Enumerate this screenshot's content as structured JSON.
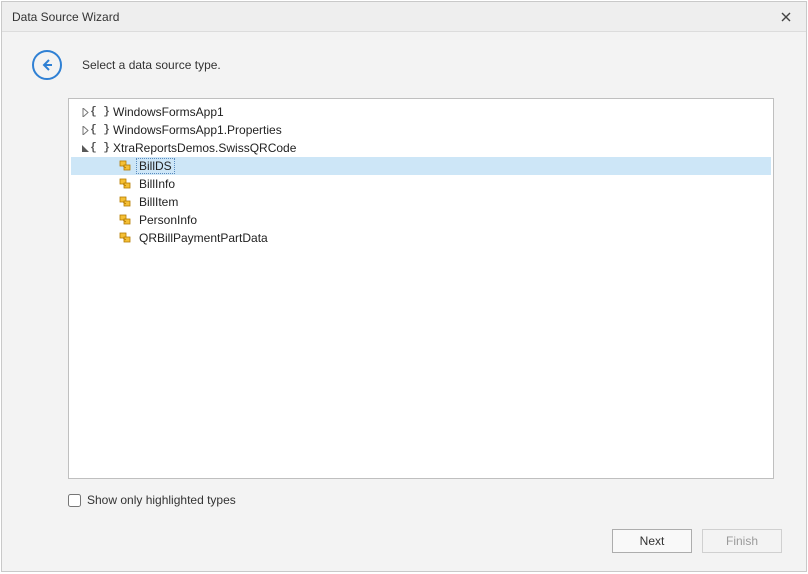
{
  "window": {
    "title": "Data Source Wizard"
  },
  "header": {
    "instruction": "Select a data source type."
  },
  "tree": {
    "nodes": [
      {
        "label": "WindowsFormsApp1",
        "expanded": false,
        "level": 1,
        "kind": "ns"
      },
      {
        "label": "WindowsFormsApp1.Properties",
        "expanded": false,
        "level": 1,
        "kind": "ns"
      },
      {
        "label": "XtraReportsDemos.SwissQRCode",
        "expanded": true,
        "level": 1,
        "kind": "ns"
      },
      {
        "label": "BillDS",
        "level": 2,
        "kind": "class",
        "selected": true
      },
      {
        "label": "BillInfo",
        "level": 2,
        "kind": "class"
      },
      {
        "label": "BillItem",
        "level": 2,
        "kind": "class"
      },
      {
        "label": "PersonInfo",
        "level": 2,
        "kind": "class"
      },
      {
        "label": "QRBillPaymentPartData",
        "level": 2,
        "kind": "class"
      }
    ]
  },
  "checkbox": {
    "label": "Show only highlighted types",
    "checked": false
  },
  "buttons": {
    "next": "Next",
    "finish": "Finish"
  }
}
